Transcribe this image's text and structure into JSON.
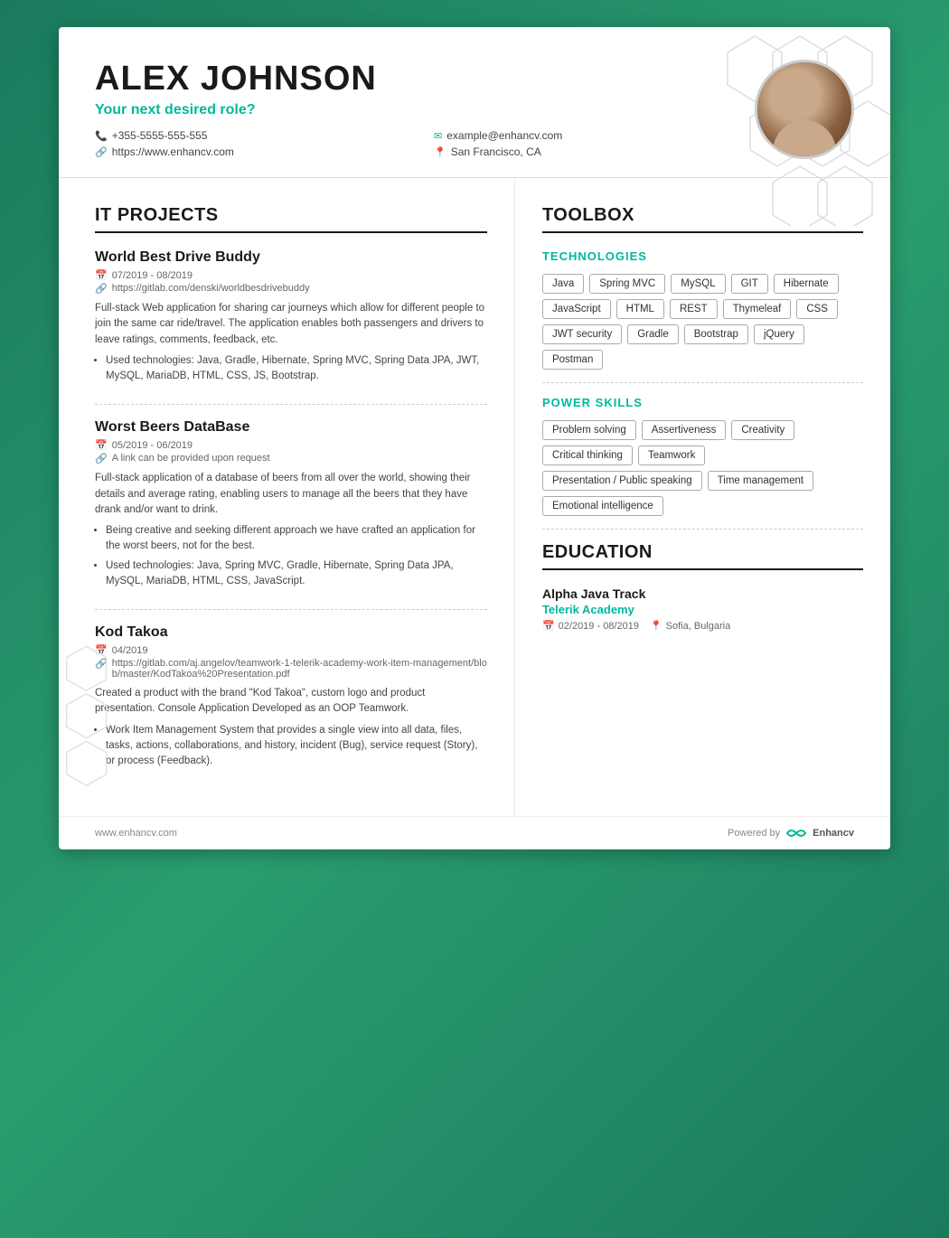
{
  "header": {
    "name": "ALEX JOHNSON",
    "role": "Your next desired role?",
    "phone": "+355-5555-555-555",
    "website": "https://www.enhancv.com",
    "email": "example@enhancv.com",
    "location": "San Francisco, CA"
  },
  "sections": {
    "it_projects": {
      "title": "IT PROJECTS",
      "projects": [
        {
          "title": "World Best Drive Buddy",
          "date": "07/2019 - 08/2019",
          "link": "https://gitlab.com/denski/worldbesdrivebuddy",
          "description": "Full-stack Web application for sharing car journeys which allow for different people to join the same car ride/travel. The application enables both passengers and drivers to leave ratings, comments, feedback, etc.",
          "bullets": [
            "Used technologies: Java, Gradle, Hibernate, Spring MVC, Spring Data JPA, JWT, MySQL, MariaDB, HTML, CSS, JS, Bootstrap."
          ]
        },
        {
          "title": "Worst Beers DataBase",
          "date": "05/2019 - 06/2019",
          "link": "A link can be provided upon request",
          "description": "Full-stack application of a database of beers from all over the world, showing their details and average rating, enabling users to manage all the beers that they have drank and/or want to drink.",
          "bullets": [
            "Being creative and seeking different approach we have crafted an application for the worst beers, not for the best.",
            "Used technologies: Java, Spring MVC, Gradle, Hibernate, Spring Data JPA, MySQL, MariaDB, HTML, CSS, JavaScript."
          ]
        },
        {
          "title": "Kod Takoa",
          "date": "04/2019",
          "link": "https://gitlab.com/aj.angelov/teamwork-1-telerik-academy-work-item-management/blob/master/KodTakoa%20Presentation.pdf",
          "description": "Created a product with the brand \"Kod Takoa\", custom logo and product presentation. Console Application Developed as an OOP Teamwork.",
          "bullets": [
            "Work Item Management System that provides a single view into all data, files, tasks, actions, collaborations, and history, incident (Bug), service request (Story), or process (Feedback)."
          ]
        }
      ]
    },
    "toolbox": {
      "title": "TOOLBOX",
      "technologies": {
        "subtitle": "TECHNOLOGIES",
        "tags": [
          "Java",
          "Spring MVC",
          "MySQL",
          "GIT",
          "Hibernate",
          "JavaScript",
          "HTML",
          "REST",
          "Thymeleaf",
          "CSS",
          "JWT security",
          "Gradle",
          "Bootstrap",
          "jQuery",
          "Postman"
        ]
      },
      "power_skills": {
        "subtitle": "POWER SKILLS",
        "tags": [
          "Problem solving",
          "Assertiveness",
          "Creativity",
          "Critical thinking",
          "Teamwork",
          "Presentation / Public speaking",
          "Time management",
          "Emotional intelligence"
        ]
      }
    },
    "education": {
      "title": "EDUCATION",
      "items": [
        {
          "degree": "Alpha Java Track",
          "school": "Telerik Academy",
          "date": "02/2019 - 08/2019",
          "location": "Sofia, Bulgaria"
        }
      ]
    }
  },
  "footer": {
    "website": "www.enhancv.com",
    "powered_by": "Powered by",
    "brand": "Enhancv"
  }
}
